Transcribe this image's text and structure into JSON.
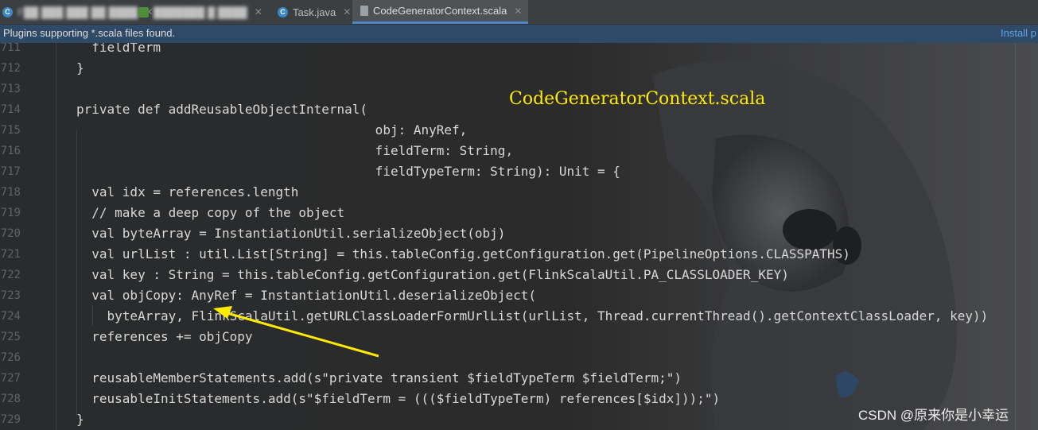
{
  "tabs": [
    {
      "label": "F██ ███ ███ ██ ████",
      "icon": "java-class-icon",
      "obscured": true
    },
    {
      "label": "███████ █ ████",
      "icon": "module-icon",
      "obscured": true
    },
    {
      "label": "Task.java",
      "icon": "java-class-icon"
    },
    {
      "label": "CodeGeneratorContext.scala",
      "icon": "scala-file-icon",
      "active": true
    }
  ],
  "banner": {
    "message": "Plugins supporting *.scala files found.",
    "action": "Install p"
  },
  "overlay_title": "CodeGeneratorContext.scala",
  "watermark": "CSDN @原来你是小幸运",
  "colors": {
    "accent": "#4a88c7",
    "overlay_text": "#ffea00",
    "arrow": "#ffea00",
    "banner_bg": "#2f4a67"
  },
  "line_numbers": [
    "711",
    "712",
    "713",
    "714",
    "715",
    "716",
    "717",
    "718",
    "719",
    "720",
    "721",
    "722",
    "723",
    "724",
    "725",
    "726",
    "727",
    "728",
    "729"
  ],
  "code_lines": [
    "  fieldTerm",
    "}",
    "",
    "private def addReusableObjectInternal(",
    "                                       obj: AnyRef,",
    "                                       fieldTerm: String,",
    "                                       fieldTypeTerm: String): Unit = {",
    "  val idx = references.length",
    "  // make a deep copy of the object",
    "  val byteArray = InstantiationUtil.serializeObject(obj)",
    "  val urlList : util.List[String] = this.tableConfig.getConfiguration.get(PipelineOptions.CLASSPATHS)",
    "  val key : String = this.tableConfig.getConfiguration.get(FlinkScalaUtil.PA_CLASSLOADER_KEY)",
    "  val objCopy: AnyRef = InstantiationUtil.deserializeObject(",
    "    byteArray, FlinkScalaUtil.getURLClassLoaderFormUrlList(urlList, Thread.currentThread().getContextClassLoader, key))",
    "  references += objCopy",
    "",
    "  reusableMemberStatements.add(s\"private transient $fieldTypeTerm $fieldTerm;\")",
    "  reusableInitStatements.add(s\"$fieldTerm = ((($fieldTypeTerm) references[$idx]));\")",
    "}"
  ]
}
